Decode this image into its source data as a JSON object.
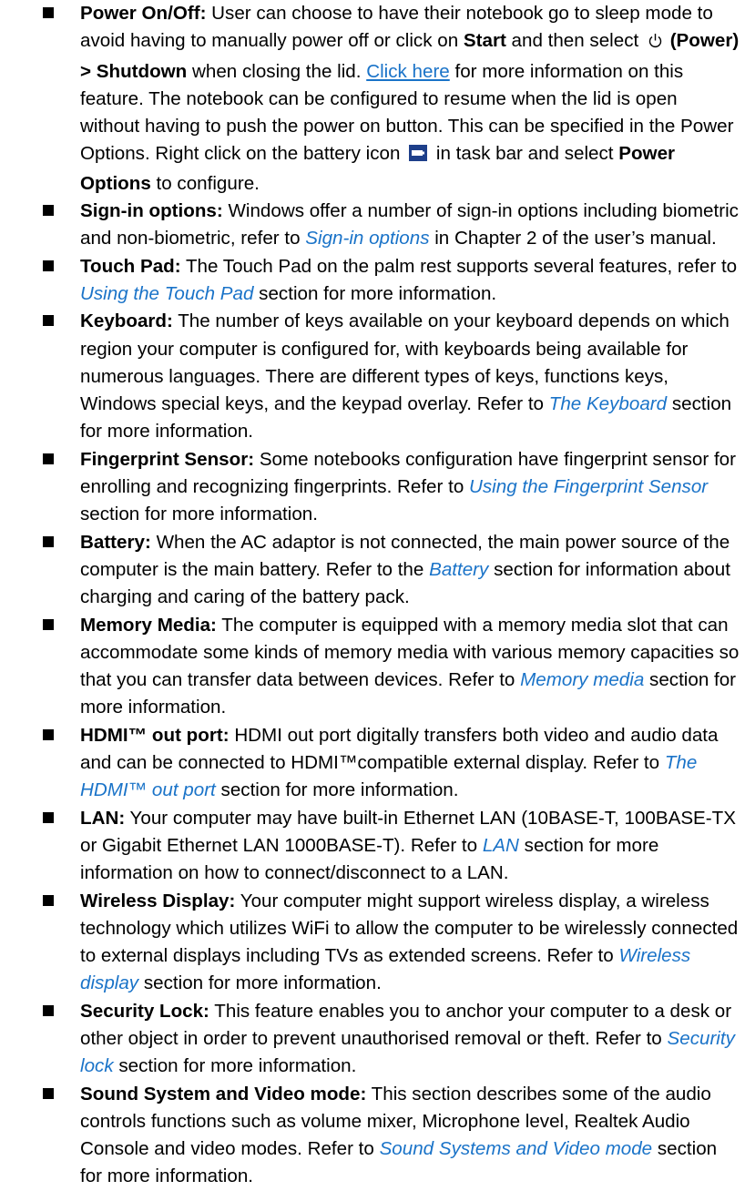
{
  "items": [
    {
      "title": "Power On/Off:",
      "t1": "User can choose to have their notebook go to sleep mode to avoid having to manually power off or click on",
      "start_label": "Start",
      "t2": "and then select",
      "power_label": "(Power) > Shutdown",
      "t3": "when closing the lid.",
      "link": "Click here",
      "t4": "for more information on this feature. The notebook can be configured to resume when the lid is open without having to push the power on button. This can be specified in the Power Options. Right click on the battery icon",
      "t5": "in task bar and select",
      "options_label": "Power Options",
      "t6": "to configure."
    },
    {
      "title": "Sign-in options:",
      "t1": "Windows offer a number of sign-in options including biometric and non-biometric, refer to",
      "ref": "Sign-in options",
      "t2": "in Chapter 2 of the user’s manual."
    },
    {
      "title": "Touch Pad:",
      "t1": "The Touch Pad on the palm rest supports several features, refer to",
      "ref": "Using the Touch Pad",
      "t2": "section for more information."
    },
    {
      "title": "Keyboard:",
      "t1": "The number of keys available on your keyboard depends on which region your computer is configured for, with keyboards being available for numerous languages. There are different types of keys, functions keys, Windows special keys, and the keypad overlay. Refer to",
      "ref": "The Keyboard",
      "t2": "section for more information."
    },
    {
      "title": "Fingerprint Sensor:",
      "t1": "Some notebooks configuration have fingerprint sensor for enrolling and recognizing fingerprints. Refer to",
      "ref": "Using the Fingerprint Sensor",
      "t2": "section for more information."
    },
    {
      "title": "Battery:",
      "t1": "When the AC adaptor is not connected, the main power source of the computer is the main battery. Refer to the",
      "ref": "Battery",
      "t2": "section for information about charging and caring of the battery pack."
    },
    {
      "title": "Memory Media:",
      "t1": "The computer is equipped with a memory media slot that can accommodate some kinds of memory media with various memory capacities so that you can transfer data between devices. Refer to",
      "ref": "Memory media",
      "t2": "section for more information."
    },
    {
      "title": "HDMI™ out port:",
      "t1": "HDMI out port digitally transfers both video and audio data and can be connected to HDMI™compatible external display. Refer to",
      "ref": "The HDMI™ out port",
      "t2": "section for more information."
    },
    {
      "title": "LAN:",
      "t1": "Your computer may have built-in Ethernet LAN (10BASE-T, 100BASE-TX or Gigabit Ethernet LAN 1000BASE-T). Refer to",
      "ref": "LAN",
      "t2": "section for more information on how to connect/disconnect to a LAN."
    },
    {
      "title": "Wireless Display:",
      "t1": "Your computer might support wireless display, a wireless technology which utilizes WiFi to allow the computer to be wirelessly connected to external displays including TVs as extended screens. Refer to",
      "ref": "Wireless display",
      "t2": "section for more information."
    },
    {
      "title": "Security Lock:",
      "t1": "This feature enables you to anchor your computer to a desk or other object in order to prevent unauthorised removal or theft. Refer to",
      "ref": "Security lock",
      "t2": "section for more information."
    },
    {
      "title": "Sound System and Video mode:",
      "t1": "This section describes some of the audio controls functions such as volume mixer, Microphone level, Realtek Audio Console and video modes. Refer to",
      "ref": "Sound Systems and Video mode",
      "t2": "section for more information."
    }
  ],
  "colors": {
    "link": "#1a73c8",
    "text": "#000000",
    "bullet": "#000000"
  },
  "icons": {
    "power": "power-icon",
    "battery": "battery-icon",
    "bullet": "square-bullet"
  }
}
